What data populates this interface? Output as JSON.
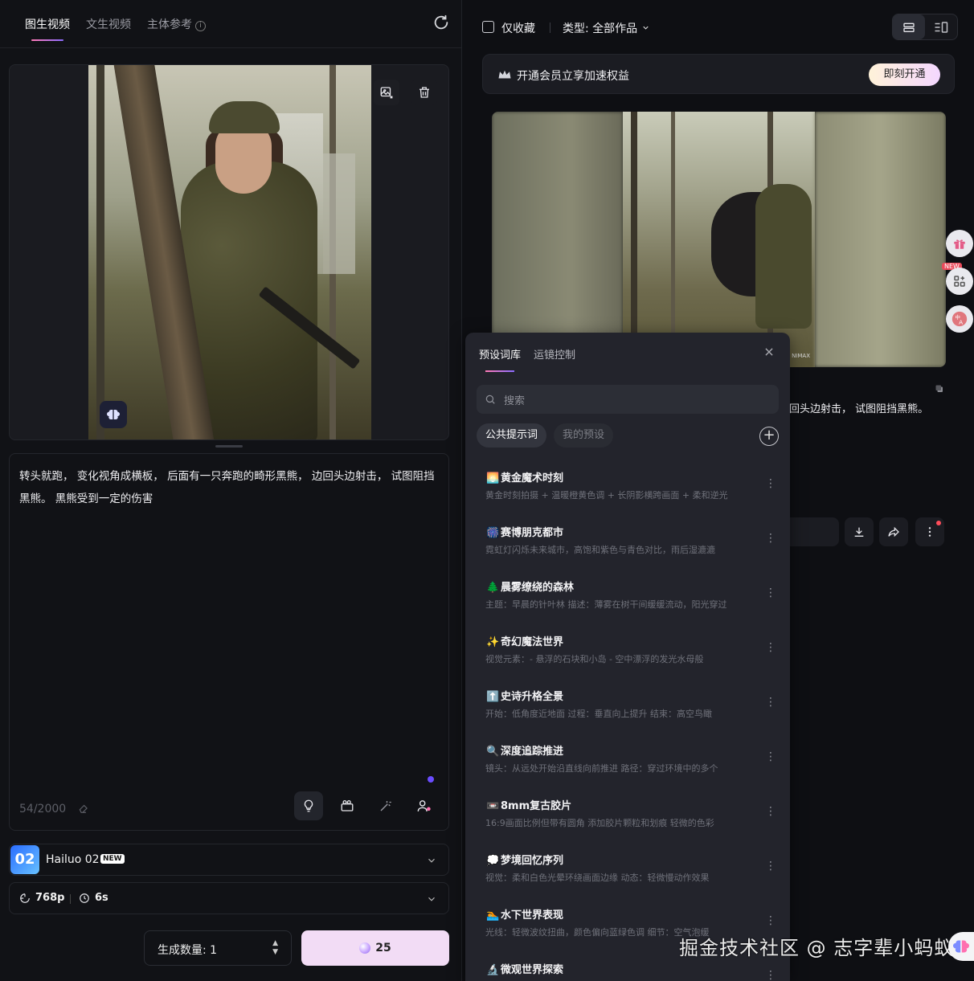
{
  "left": {
    "tabs": [
      {
        "label": "图生视频",
        "active": true
      },
      {
        "label": "文生视频",
        "active": false
      },
      {
        "label": "主体参考",
        "active": false
      }
    ],
    "info_glyph": "i",
    "prompt": "转头就跑，  变化视角成横板，  后面有一只奔跑的畸形黑熊，  边回头边射击，  试图阻挡黑熊。  黑熊受到一定的伤害",
    "char_count": "54/2000",
    "model": {
      "thumb_text": "02",
      "name": "Hailuo 02",
      "badge": "NEW"
    },
    "resolution": "768p",
    "duration": "6s",
    "quantity_label": "生成数量: 1",
    "stepper_up": "▲",
    "stepper_down": "▼",
    "generate_cost": "25"
  },
  "right": {
    "favorites_only_label": "仅收藏",
    "favorites_only_checked": false,
    "type_filter_label": "类型:",
    "type_filter_value": "全部作品",
    "vip_text": "开通会员立享加速权益",
    "vip_button": "即刻开通",
    "video_watermark": "NIMAX",
    "video_caption_visible": "回头边射击，  试图阻挡黑熊。",
    "fab_new_badge": "NEW"
  },
  "popup": {
    "tabs": [
      {
        "label": "预设词库",
        "active": true
      },
      {
        "label": "运镜控制",
        "active": false
      }
    ],
    "close_glyph": "✕",
    "search_placeholder": "搜索",
    "chips": [
      {
        "label": "公共提示词",
        "active": true
      },
      {
        "label": "我的预设",
        "active": false
      }
    ],
    "add_glyph": "+",
    "items": [
      {
        "emoji": "🌅",
        "title": "黄金魔术时刻",
        "desc": "黄金时刻拍摄 + 温暖橙黄色调 + 长阴影横跨画面 + 柔和逆光",
        "menu": "⋮"
      },
      {
        "emoji": "🎆",
        "title": "赛博朋克都市",
        "desc": "霓虹灯闪烁未来城市，高饱和紫色与青色对比，雨后湿漉漉",
        "menu": "⋮"
      },
      {
        "emoji": "🌲",
        "title": "晨雾缭绕的森林",
        "desc": "主题：早晨的针叶林 描述：薄雾在树干间缓缓流动，阳光穿过",
        "menu": "⋮"
      },
      {
        "emoji": "✨",
        "title": "奇幻魔法世界",
        "desc": "视觉元素：- 悬浮的石块和小岛 - 空中漂浮的发光水母般",
        "menu": "⋮"
      },
      {
        "emoji": "⬆️",
        "title": "史诗升格全景",
        "desc": "开始：低角度近地面 过程：垂直向上提升 结束：高空鸟瞰",
        "menu": "⋮"
      },
      {
        "emoji": "🔍",
        "title": "深度追踪推进",
        "desc": "镜头：从远处开始沿直线向前推进 路径：穿过环境中的多个",
        "menu": "⋮"
      },
      {
        "emoji": "📼",
        "title": "8mm复古胶片",
        "desc": "16:9画面比例但带有圆角 添加胶片颗粒和划痕 轻微的色彩",
        "menu": "⋮"
      },
      {
        "emoji": "💭",
        "title": "梦境回忆序列",
        "desc": "视觉：柔和白色光晕环绕画面边缘 动态：轻微慢动作效果",
        "menu": "⋮"
      },
      {
        "emoji": "🏊",
        "title": "水下世界表现",
        "desc": "光线：轻微波纹扭曲，颜色偏向蓝绿色调 细节：空气泡缓",
        "menu": "⋮"
      },
      {
        "emoji": "🔬",
        "title": "微观世界探索",
        "desc": "",
        "menu": "⋮"
      }
    ]
  },
  "watermark_text": "掘金技术社区 @ 志字辈小蚂蚁",
  "colors": {
    "accent_gradient_start": "#ff7ab6",
    "accent_gradient_end": "#8b6cff",
    "generate_button": "#f2dcf5",
    "background": "#0e0f13"
  },
  "icons": [
    "refresh-icon",
    "info-icon",
    "image-replace-icon",
    "trash-icon",
    "brain-icon",
    "eraser-icon",
    "lightbulb-icon",
    "clapper-icon",
    "magic-wand-icon",
    "character-icon",
    "chevron-down-icon",
    "aspect-icon",
    "clock-icon",
    "gem-icon",
    "list-view-icon",
    "grid-view-icon",
    "crown-icon",
    "copy-icon",
    "download-icon",
    "share-icon",
    "more-icon",
    "gift-icon",
    "apps-icon",
    "translate-icon",
    "search-icon",
    "close-icon",
    "plus-icon"
  ]
}
